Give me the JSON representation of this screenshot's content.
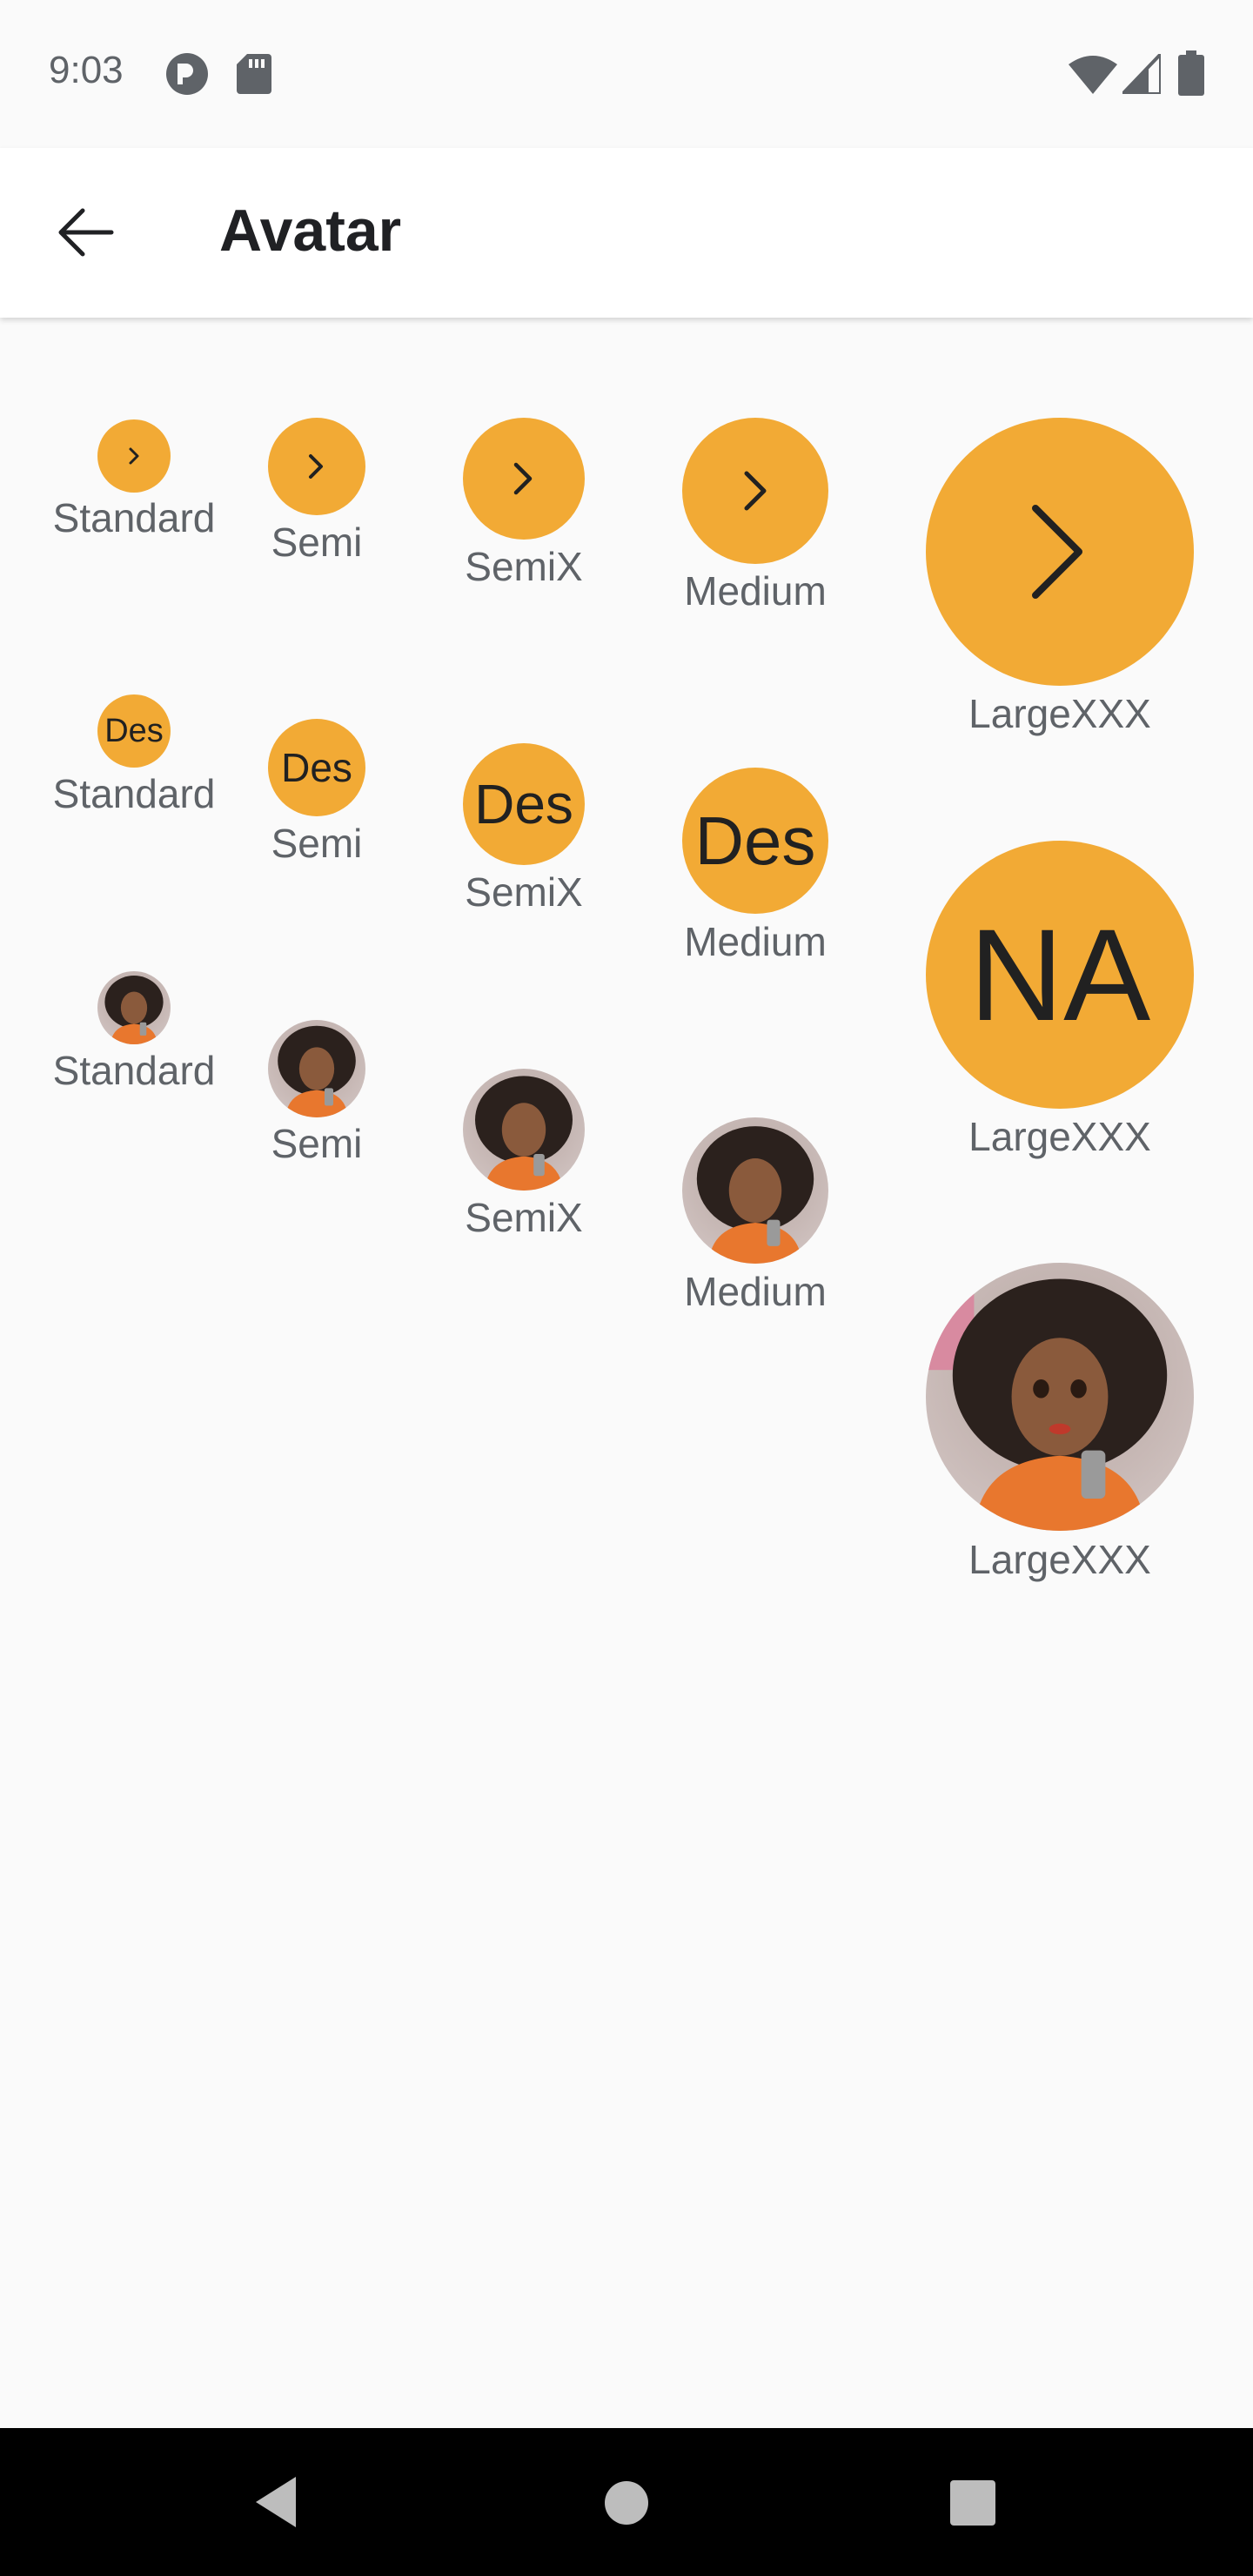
{
  "status_bar": {
    "time": "9:03"
  },
  "app_bar": {
    "title": "Avatar"
  },
  "colors": {
    "avatar_bg": "#f2aa35",
    "caption": "#5f6368"
  },
  "grid": {
    "rows": [
      {
        "type": "icon",
        "icon": "chevron-right-icon",
        "items": [
          {
            "size_label": "Standard"
          },
          {
            "size_label": "Semi"
          },
          {
            "size_label": "SemiX"
          },
          {
            "size_label": "Medium"
          },
          {
            "size_label": "LargeXXX"
          }
        ]
      },
      {
        "type": "initials",
        "items": [
          {
            "initials": "Des",
            "size_label": "Standard"
          },
          {
            "initials": "Des",
            "size_label": "Semi"
          },
          {
            "initials": "Des",
            "size_label": "SemiX"
          },
          {
            "initials": "Des",
            "size_label": "Medium"
          },
          {
            "initials": "NA",
            "size_label": "LargeXXX"
          }
        ]
      },
      {
        "type": "image",
        "items": [
          {
            "size_label": "Standard"
          },
          {
            "size_label": "Semi"
          },
          {
            "size_label": "SemiX"
          },
          {
            "size_label": "Medium"
          },
          {
            "size_label": "LargeXXX"
          }
        ]
      }
    ]
  }
}
